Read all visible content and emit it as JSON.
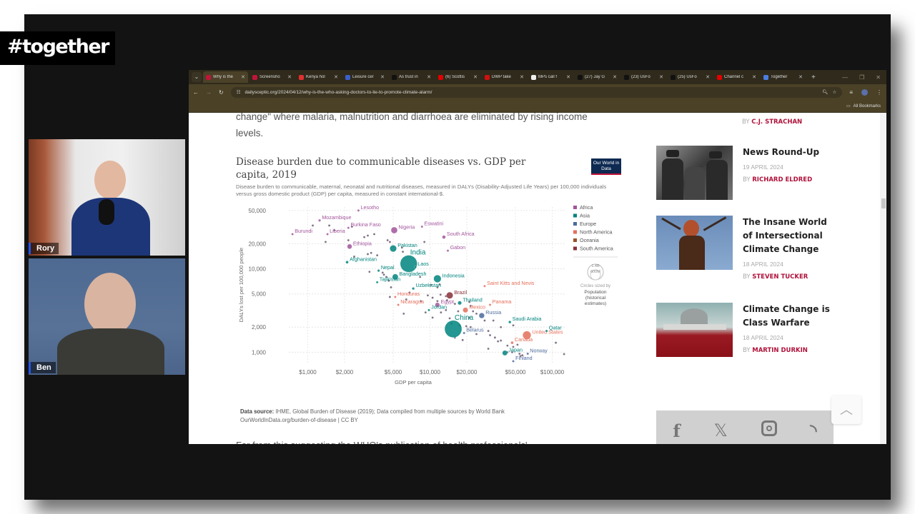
{
  "overlay": {
    "hashtag": "#together",
    "participants": [
      {
        "name": "Rory"
      },
      {
        "name": "Ben"
      }
    ]
  },
  "browser": {
    "tabs": [
      {
        "title": "Why is the",
        "favicon": "dailysceptic-icon",
        "color": "#c0153a",
        "active": true
      },
      {
        "title": "Screensho",
        "favicon": "dailysceptic-icon",
        "color": "#c0153a",
        "active": false
      },
      {
        "title": "Kenya hol",
        "favicon": "mail-icon",
        "color": "#e03030",
        "active": false
      },
      {
        "title": "Leisure cer",
        "favicon": "g-icon",
        "color": "#3a5fcd",
        "active": false
      },
      {
        "title": "As trust in",
        "favicon": "g-icon",
        "color": "#111111",
        "active": false
      },
      {
        "title": "(6) Scottis",
        "favicon": "youtube-icon",
        "color": "#e00000",
        "active": false
      },
      {
        "title": "DWP take",
        "favicon": "dwp-icon",
        "color": "#d01010",
        "active": false
      },
      {
        "title": "MPs call f",
        "favicon": "u-icon",
        "color": "#eeeeee",
        "active": false
      },
      {
        "title": "(27) Jay G",
        "favicon": "x-icon",
        "color": "#111111",
        "active": false
      },
      {
        "title": "(23) UsFo",
        "favicon": "x-icon",
        "color": "#111111",
        "active": false
      },
      {
        "title": "(25) UsFo",
        "favicon": "x-icon",
        "color": "#111111",
        "active": false
      },
      {
        "title": "Channel c",
        "favicon": "youtube-icon",
        "color": "#e00000",
        "active": false
      },
      {
        "title": "Together",
        "favicon": "doc-icon",
        "color": "#4a7de0",
        "active": false
      }
    ],
    "url": "dailysceptic.org/2024/04/12/why-is-the-who-asking-doctors-to-lie-to-promote-climate-alarm/",
    "bookmarks_label": "All Bookmarks"
  },
  "article": {
    "intro_line1": "change\" where malaria, malnutrition and diarrhoea are eliminated by rising income",
    "intro_line2": "levels.",
    "below_text": "Far from this suggesting the WHO's publication of health professionals' ..."
  },
  "chart": {
    "title": "Disease burden due to communicable diseases vs. GDP per capita, 2019",
    "subtitle": "Disease burden to communicable, maternal, neonatal and nutritional diseases, measured in DALYs (Disability-Adjusted Life Years) per 100,000 individuals versus gross domestic product (GDP) per capita, measured in constant international-$.",
    "logo": "Our World in Data",
    "source_label": "Data source:",
    "source_text": "IHME, Global Burden of Disease (2019); Data compiled from multiple sources by World Bank",
    "source_url": "OurWorldInData.org/burden-of-disease | CC BY",
    "size_legend": {
      "top": "1.4B",
      "bottom": "600M",
      "caption": "Circles sized by",
      "measure": "Population (historical estimates)"
    }
  },
  "chart_data": {
    "type": "scatter",
    "title": "Disease burden due to communicable diseases vs. GDP per capita, 2019",
    "xlabel": "GDP per capita",
    "ylabel": "DALYs lost per 100,000 people",
    "xscale": "log",
    "yscale": "log",
    "xlim": [
      700,
      130000
    ],
    "ylim": [
      750,
      55000
    ],
    "xticks": [
      1000,
      2000,
      5000,
      10000,
      20000,
      50000,
      100000
    ],
    "xtick_labels": [
      "$1,000",
      "$2,000",
      "$5,000",
      "$10,000",
      "$20,000",
      "$50,000",
      "$100,000"
    ],
    "yticks": [
      1000,
      2000,
      5000,
      10000,
      20000,
      50000
    ],
    "ytick_labels": [
      "1,000",
      "2,000",
      "5,000",
      "10,000",
      "20,000",
      "50,000"
    ],
    "grid": true,
    "legend": {
      "placement": "right",
      "entries": [
        {
          "name": "Africa",
          "color": "#a2559c"
        },
        {
          "name": "Asia",
          "color": "#00847e"
        },
        {
          "name": "Europe",
          "color": "#4c6a9c"
        },
        {
          "name": "North America",
          "color": "#e56e5a"
        },
        {
          "name": "Oceania",
          "color": "#9a5129"
        },
        {
          "name": "South America",
          "color": "#883039"
        }
      ]
    },
    "points": [
      {
        "label": "Lesotho",
        "x": 2600,
        "y": 50000,
        "region": "Africa",
        "pop": 2
      },
      {
        "label": "Mozambique",
        "x": 1250,
        "y": 38000,
        "region": "Africa",
        "pop": 30
      },
      {
        "label": "Burundi",
        "x": 750,
        "y": 26000,
        "region": "Africa",
        "pop": 12
      },
      {
        "label": "Liberia",
        "x": 1450,
        "y": 26000,
        "region": "Africa",
        "pop": 5
      },
      {
        "label": "Burkina Faso",
        "x": 2150,
        "y": 31000,
        "region": "Africa",
        "pop": 20
      },
      {
        "label": "Nigeria",
        "x": 5100,
        "y": 29000,
        "region": "Africa",
        "pop": 200
      },
      {
        "label": "Eswatini",
        "x": 8600,
        "y": 32000,
        "region": "Africa",
        "pop": 1
      },
      {
        "label": "South Africa",
        "x": 13000,
        "y": 24000,
        "region": "Africa",
        "pop": 58
      },
      {
        "label": "Ethiopia",
        "x": 2200,
        "y": 18500,
        "region": "Africa",
        "pop": 112
      },
      {
        "label": "Gabon",
        "x": 14000,
        "y": 16500,
        "region": "Africa",
        "pop": 2
      },
      {
        "label": "Pakistan",
        "x": 5000,
        "y": 17500,
        "region": "Asia",
        "pop": 217
      },
      {
        "label": "India",
        "x": 6700,
        "y": 11500,
        "region": "Asia",
        "pop": 1380
      },
      {
        "label": "Laos",
        "x": 7600,
        "y": 10500,
        "region": "Asia",
        "pop": 7
      },
      {
        "label": "Afghanistan",
        "x": 2100,
        "y": 12000,
        "region": "Asia",
        "pop": 38
      },
      {
        "label": "Nepal",
        "x": 3800,
        "y": 9500,
        "region": "Asia",
        "pop": 29
      },
      {
        "label": "Bangladesh",
        "x": 5200,
        "y": 8000,
        "region": "Asia",
        "pop": 163
      },
      {
        "label": "Indonesia",
        "x": 11500,
        "y": 7600,
        "region": "Asia",
        "pop": 270
      },
      {
        "label": "Tajikistan",
        "x": 3700,
        "y": 6900,
        "region": "Asia",
        "pop": 9
      },
      {
        "label": "Uzbekistan",
        "x": 7300,
        "y": 5800,
        "region": "Asia",
        "pop": 33
      },
      {
        "label": "Brazil",
        "x": 14500,
        "y": 4800,
        "region": "South America",
        "pop": 211
      },
      {
        "label": "Saint Kitts and Nevis",
        "x": 28000,
        "y": 6200,
        "region": "North America",
        "pop": 1
      },
      {
        "label": "Honduras",
        "x": 5200,
        "y": 4600,
        "region": "North America",
        "pop": 10
      },
      {
        "label": "Nicaragua",
        "x": 5500,
        "y": 3700,
        "region": "North America",
        "pop": 6
      },
      {
        "label": "Egypt",
        "x": 11500,
        "y": 3700,
        "region": "Africa",
        "pop": 100
      },
      {
        "label": "Thailand",
        "x": 17500,
        "y": 3900,
        "region": "Asia",
        "pop": 70
      },
      {
        "label": "Panama",
        "x": 31000,
        "y": 3700,
        "region": "North America",
        "pop": 4
      },
      {
        "label": "Jordan",
        "x": 9800,
        "y": 3200,
        "region": "Asia",
        "pop": 10
      },
      {
        "label": "Mexico",
        "x": 19500,
        "y": 3200,
        "region": "North America",
        "pop": 128
      },
      {
        "label": "Russia",
        "x": 26500,
        "y": 2750,
        "region": "Europe",
        "pop": 145
      },
      {
        "label": "China",
        "x": 15500,
        "y": 1900,
        "region": "Asia",
        "pop": 1410
      },
      {
        "label": "Belarus",
        "x": 19000,
        "y": 1700,
        "region": "Europe",
        "pop": 9
      },
      {
        "label": "Saudi Arabia",
        "x": 45000,
        "y": 2300,
        "region": "Asia",
        "pop": 35
      },
      {
        "label": "United States",
        "x": 62000,
        "y": 1600,
        "region": "North America",
        "pop": 330
      },
      {
        "label": "Qatar",
        "x": 90000,
        "y": 1800,
        "region": "Asia",
        "pop": 3
      },
      {
        "label": "Canada",
        "x": 47000,
        "y": 1300,
        "region": "North America",
        "pop": 38
      },
      {
        "label": "Japan",
        "x": 41000,
        "y": 980,
        "region": "Asia",
        "pop": 126
      },
      {
        "label": "Norway",
        "x": 63000,
        "y": 960,
        "region": "Europe",
        "pop": 5
      },
      {
        "label": "Finland",
        "x": 48000,
        "y": 780,
        "region": "Europe",
        "pop": 6
      }
    ],
    "unlabeled_points": [
      [
        1100,
        33000
      ],
      [
        1500,
        33000
      ],
      [
        1650,
        29000
      ],
      [
        2300,
        32000
      ],
      [
        1400,
        21000
      ],
      [
        2150,
        22000
      ],
      [
        2900,
        24000
      ],
      [
        3100,
        25000
      ],
      [
        3500,
        26000
      ],
      [
        4500,
        22000
      ],
      [
        4700,
        21000
      ],
      [
        5900,
        18000
      ],
      [
        9000,
        21000
      ],
      [
        2400,
        14000
      ],
      [
        3100,
        15000
      ],
      [
        3300,
        15500
      ],
      [
        3700,
        14500
      ],
      [
        6000,
        16000
      ],
      [
        3200,
        9200
      ],
      [
        4100,
        9000
      ],
      [
        4200,
        8500
      ],
      [
        4400,
        8000
      ],
      [
        4600,
        7200
      ],
      [
        8300,
        8000
      ],
      [
        10200,
        6400
      ],
      [
        11500,
        6000
      ],
      [
        12000,
        6500
      ],
      [
        4800,
        6000
      ],
      [
        6800,
        5200
      ],
      [
        9600,
        4800
      ],
      [
        10500,
        4500
      ],
      [
        12200,
        4900
      ],
      [
        13500,
        4700
      ],
      [
        4700,
        4600
      ],
      [
        6400,
        4300
      ],
      [
        8400,
        4100
      ],
      [
        11500,
        4100
      ],
      [
        13800,
        4200
      ],
      [
        16000,
        3800
      ],
      [
        21000,
        4000
      ],
      [
        21500,
        3600
      ],
      [
        6100,
        2900
      ],
      [
        9200,
        3000
      ],
      [
        12300,
        3000
      ],
      [
        13500,
        3200
      ],
      [
        17000,
        3100
      ],
      [
        22500,
        3100
      ],
      [
        24000,
        2900
      ],
      [
        10500,
        2600
      ],
      [
        14500,
        2550
      ],
      [
        21000,
        2600
      ],
      [
        28000,
        2400
      ],
      [
        33000,
        2400
      ],
      [
        15000,
        2200
      ],
      [
        17500,
        2100
      ],
      [
        19800,
        2050
      ],
      [
        21500,
        2000
      ],
      [
        30000,
        1800
      ],
      [
        38000,
        2000
      ],
      [
        48000,
        2100
      ],
      [
        16000,
        1500
      ],
      [
        18500,
        1400
      ],
      [
        24000,
        1650
      ],
      [
        31000,
        1600
      ],
      [
        34000,
        1500
      ],
      [
        36000,
        1350
      ],
      [
        38000,
        1380
      ],
      [
        30000,
        1100
      ],
      [
        43000,
        1200
      ],
      [
        48000,
        1160
      ],
      [
        52000,
        1230
      ],
      [
        43000,
        1000
      ],
      [
        47000,
        1000
      ],
      [
        54000,
        960
      ],
      [
        55000,
        900
      ],
      [
        57000,
        920
      ],
      [
        107000,
        1300
      ],
      [
        125000,
        950
      ]
    ]
  },
  "sidebar": {
    "top_byline": {
      "by": "BY",
      "author": "C.J. STRACHAN"
    },
    "posts": [
      {
        "title": "News Round-Up",
        "date": "19 APRIL 2024",
        "by": "BY",
        "author": "RICHARD ELDRED",
        "thumb": "bw-photo"
      },
      {
        "title": "The Insane World of Intersectional Climate Change",
        "date": "18 APRIL 2024",
        "by": "BY",
        "author": "STEVEN TUCKER",
        "thumb": "tree-costume-photo"
      },
      {
        "title": "Climate Change is Class Warfare",
        "date": "18 APRIL 2024",
        "by": "BY",
        "author": "MARTIN DURKIN",
        "thumb": "protest-photo"
      }
    ],
    "social": [
      "facebook-icon",
      "x-icon",
      "instagram-icon",
      "rss-icon"
    ]
  }
}
